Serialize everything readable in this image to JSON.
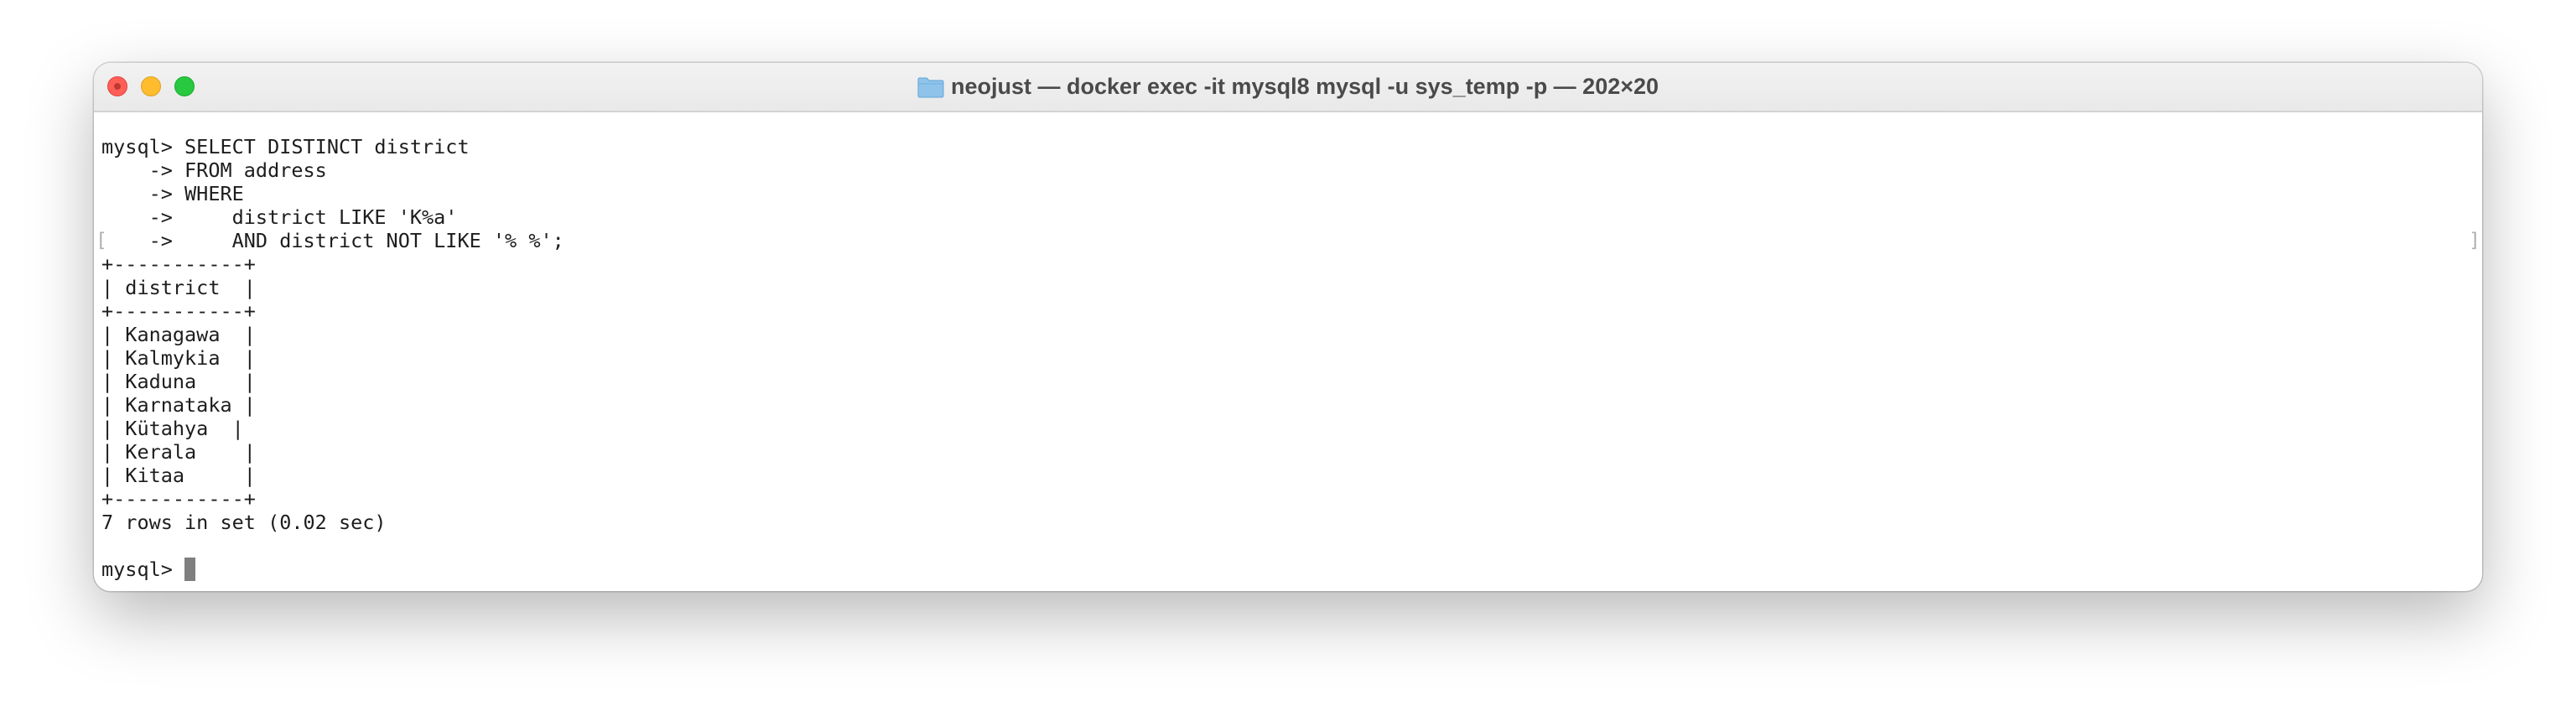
{
  "window": {
    "title": "neojust — docker exec -it mysql8 mysql -u sys_temp -p — 202×20"
  },
  "icons": {
    "folder": "folder-icon",
    "close": "close-icon",
    "minimize": "minimize-icon",
    "zoom": "zoom-icon"
  },
  "colors": {
    "close": "#ff5f57",
    "minimize": "#febc2e",
    "zoom": "#28c840",
    "folder": "#8fc3ea",
    "cursor": "#7f7f7f"
  },
  "terminal": {
    "lines": [
      "mysql> SELECT DISTINCT district",
      "    -> FROM address",
      "    -> WHERE",
      "    ->     district LIKE 'K%a'",
      "    ->     AND district NOT LIKE '% %';",
      "+-----------+",
      "| district  |",
      "+-----------+",
      "| Kanagawa  |",
      "| Kalmykia  |",
      "| Kaduna    |",
      "| Karnataka |",
      "| Kütahya  |",
      "| Kerala    |",
      "| Kitaa     |",
      "+-----------+",
      "7 rows in set (0.02 sec)",
      "",
      "mysql> "
    ],
    "left_marker": "[",
    "right_marker": "]"
  }
}
